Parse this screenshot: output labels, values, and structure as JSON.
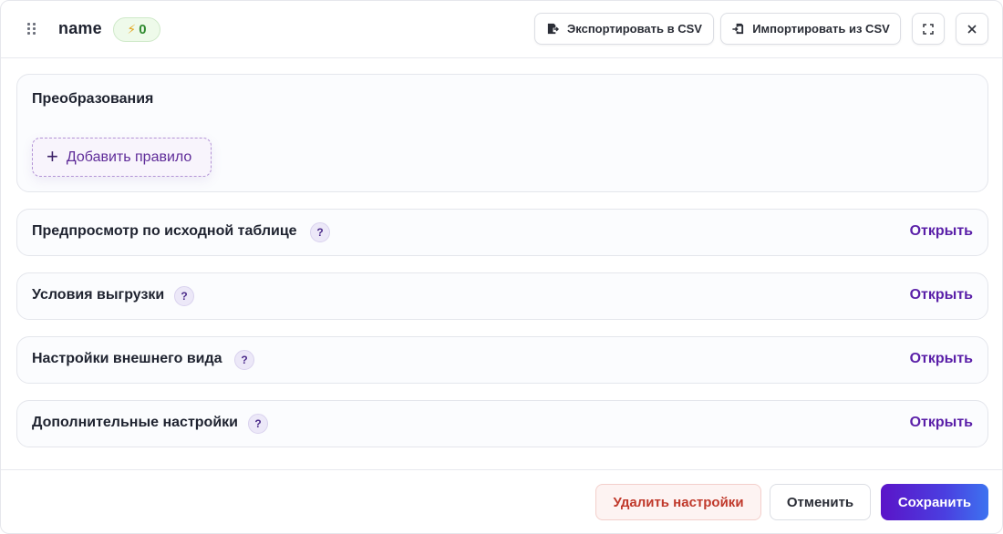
{
  "header": {
    "title": "name",
    "badge_count": "0",
    "badge_icon": "lightning-icon",
    "export_label": "Экспортировать в CSV",
    "import_label": "Импортировать из CSV"
  },
  "transformations": {
    "title": "Преобразования",
    "add_rule_label": "Добавить правило"
  },
  "sections": [
    {
      "label": "Предпросмотр по исходной таблице",
      "help": "?",
      "action": "Открыть"
    },
    {
      "label": "Условия выгрузки",
      "help": "?",
      "action": "Открыть"
    },
    {
      "label": "Настройки внешнего вида",
      "help": "?",
      "action": "Открыть"
    },
    {
      "label": "Дополнительные настройки",
      "help": "?",
      "action": "Открыть"
    }
  ],
  "footer": {
    "delete_label": "Удалить настройки",
    "cancel_label": "Отменить",
    "save_label": "Сохранить"
  },
  "colors": {
    "accent": "#5a1fa8",
    "danger": "#c0392b",
    "badge_green": "#2f8a2f"
  }
}
